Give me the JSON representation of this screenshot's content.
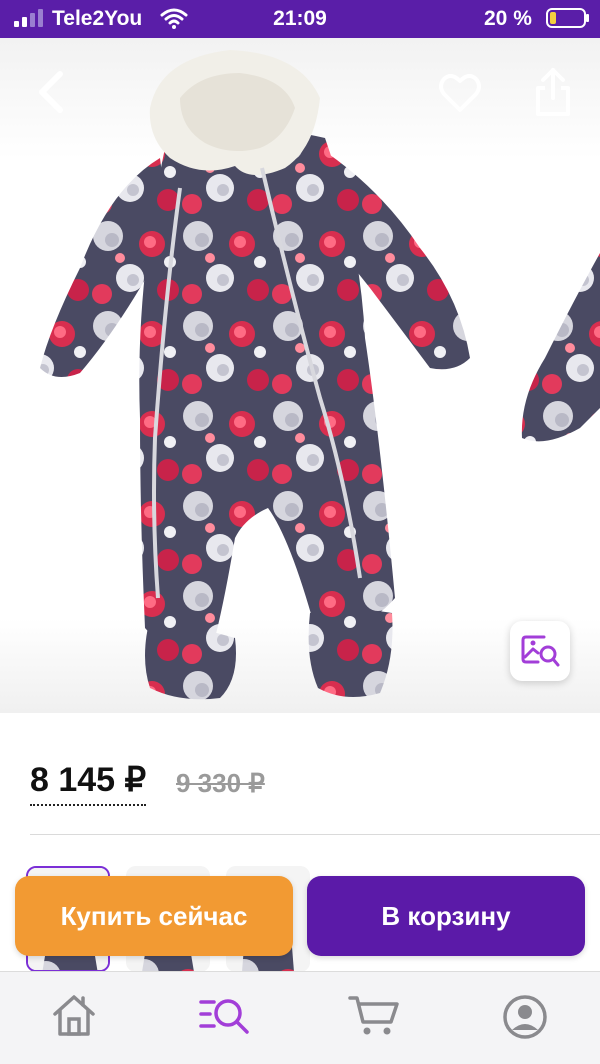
{
  "status_bar": {
    "carrier": "Tele2You",
    "time": "21:09",
    "battery": "20 %"
  },
  "product": {
    "price_current": "8 145 ₽",
    "price_old": "9 330 ₽"
  },
  "actions": {
    "buy_now": "Купить сейчас",
    "add_to_cart": "В корзину"
  },
  "icons": {
    "back": "chevron-left-icon",
    "favorite": "heart-icon",
    "share": "share-icon",
    "visual_search": "image-search-icon",
    "home": "home-icon",
    "catalog": "catalog-search-icon",
    "cart": "cart-icon",
    "profile": "profile-icon"
  },
  "colors": {
    "brand": "#5a1ea8",
    "buy_now": "#f29a33",
    "add_to_cart": "#5b1aa8",
    "active_tab": "#a23ed8"
  }
}
